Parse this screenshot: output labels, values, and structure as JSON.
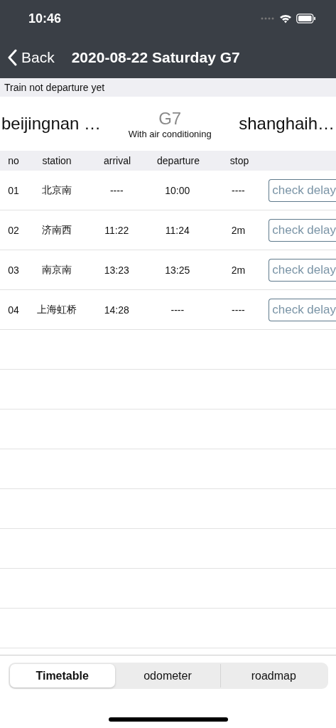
{
  "status_bar": {
    "time": "10:46"
  },
  "nav_bar": {
    "back": "Back",
    "title": "2020-08-22 Saturday G7"
  },
  "notice": "Train not departure yet",
  "route": {
    "from": "beijingnan …",
    "train": "G7",
    "service": "With air conditioning",
    "to": "shanghaih…"
  },
  "table": {
    "columns": [
      "no",
      "station",
      "arrival",
      "departure",
      "stop"
    ],
    "rows": [
      {
        "no": "01",
        "station": "北京南",
        "arrival": "----",
        "departure": "10:00",
        "stop": "----",
        "action": "check delay"
      },
      {
        "no": "02",
        "station": "济南西",
        "arrival": "11:22",
        "departure": "11:24",
        "stop": "2m",
        "action": "check delay"
      },
      {
        "no": "03",
        "station": "南京南",
        "arrival": "13:23",
        "departure": "13:25",
        "stop": "2m",
        "action": "check delay"
      },
      {
        "no": "04",
        "station": "上海虹桥",
        "arrival": "14:28",
        "departure": "----",
        "stop": "----",
        "action": "check delay"
      }
    ]
  },
  "tabs": [
    {
      "label": "Timetable",
      "selected": true
    },
    {
      "label": "odometer",
      "selected": false
    },
    {
      "label": "roadmap",
      "selected": false
    }
  ]
}
